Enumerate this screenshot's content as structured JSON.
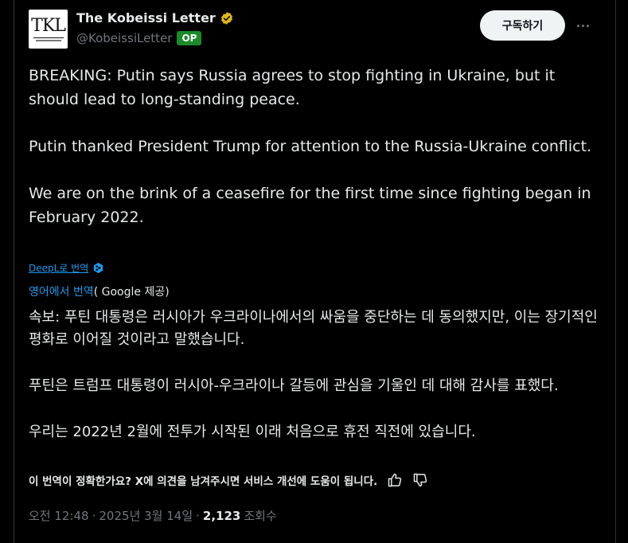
{
  "author": {
    "avatar_text": "TKL",
    "name": "The Kobeissi Letter",
    "handle": "@KobeissiLetter",
    "op_badge": "OP",
    "verified_icon": "verified-badge-icon",
    "verified_color": "#e2b719"
  },
  "actions": {
    "subscribe_label": "구독하기",
    "more_icon": "more-icon"
  },
  "tweet": {
    "p1": "BREAKING: Putin says Russia agrees to stop fighting in Ukraine, but it should lead to long-standing peace.",
    "p2": "Putin thanked President Trump for attention to the Russia-Ukraine conflict.",
    "p3": "We are on the brink of a ceasefire for the first time since fighting began in February 2022."
  },
  "translation": {
    "deepl_link": "DeepL로 번역",
    "deepl_icon": "deepl-icon",
    "google_link": "영어에서 번역",
    "google_rest": "( Google 제공)",
    "kr1": "속보: 푸틴 대통령은 러시아가 우크라이나에서의 싸움을 중단하는 데 동의했지만, 이는 장기적인 평화로 이어질 것이라고 말했습니다.",
    "kr2": "푸틴은 트럼프 대통령이 러시아-우크라이나 갈등에 관심을 기울인 데 대해 감사를 표했다.",
    "kr3": "우리는 2022년 2월에 전투가 시작된 이래 처음으로 휴전 직전에 있습니다.",
    "feedback": "이 번역이 정확한가요? X에 의견을 남겨주시면 서비스 개선에 도움이 됩니다.",
    "thumbs_up_icon": "thumbs-up-icon",
    "thumbs_down_icon": "thumbs-down-icon"
  },
  "meta": {
    "time": "오전 12:48",
    "separator": "·",
    "date": "2025년 3월 14일",
    "views_count": "2,123",
    "views_label": "조회수"
  },
  "colors": {
    "background": "#000000",
    "text": "#e7e9ea",
    "muted": "#71767b",
    "link": "#1d9bf0",
    "op_badge": "#1a8a2a"
  }
}
